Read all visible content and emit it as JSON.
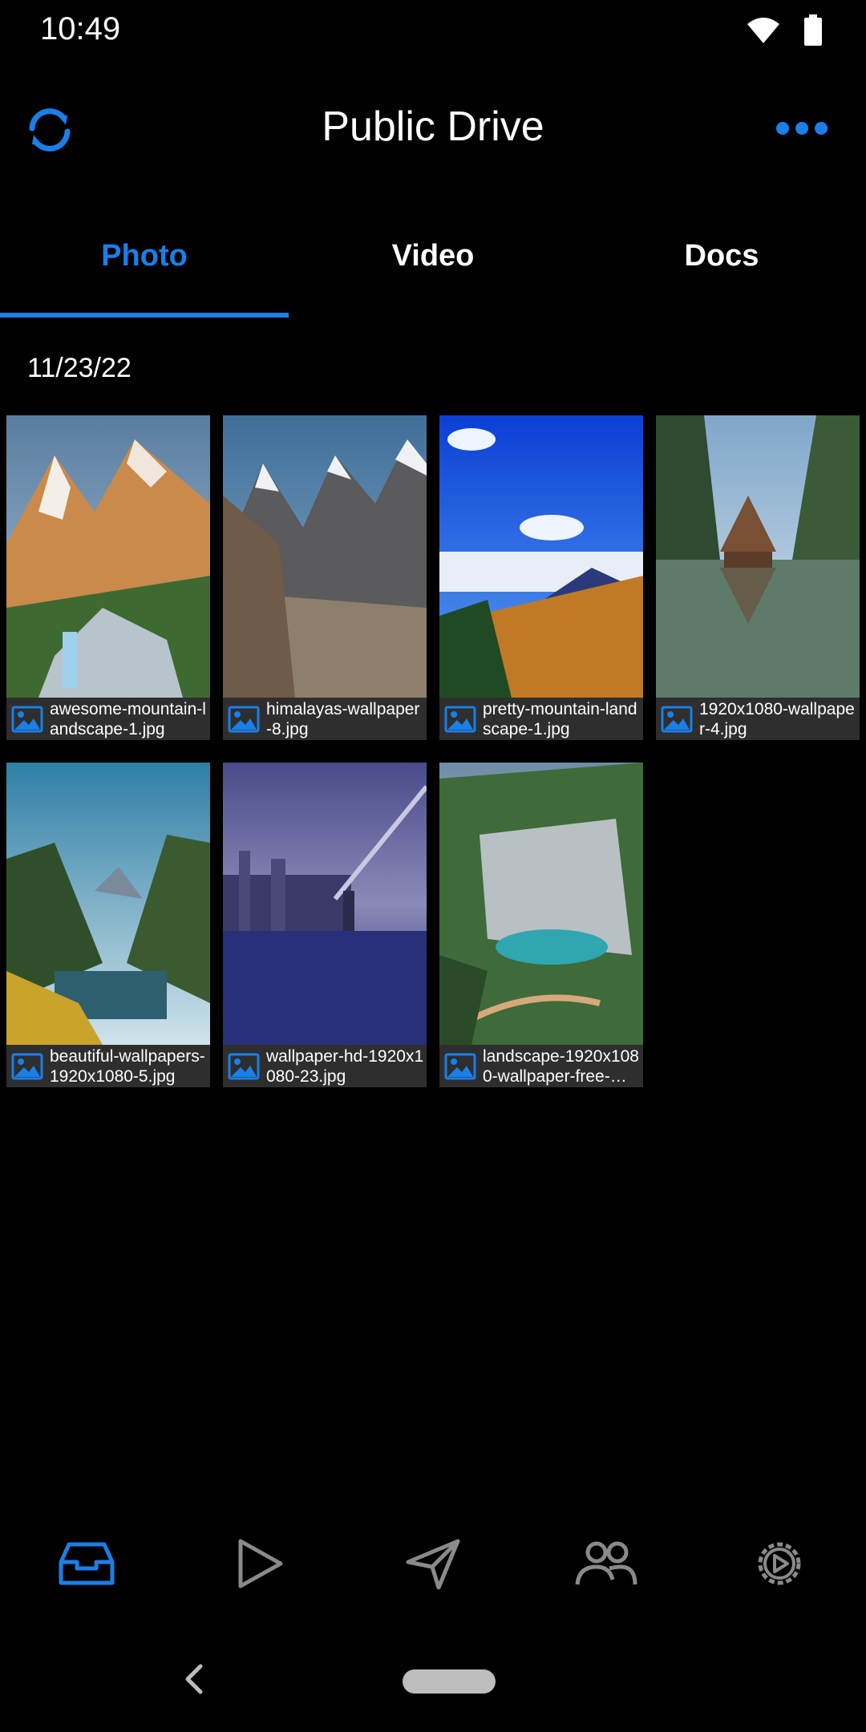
{
  "status": {
    "time": "10:49",
    "icons": [
      "wifi-icon",
      "battery-icon"
    ]
  },
  "app_bar": {
    "title": "Public Drive",
    "left_icon": "sync-icon",
    "right_icon": "more-icon"
  },
  "tabs": [
    {
      "label": "Photo",
      "active": true
    },
    {
      "label": "Video",
      "active": false
    },
    {
      "label": "Docs",
      "active": false
    }
  ],
  "date_group": "11/23/22",
  "files": [
    {
      "name": "awesome-mountain-landscape-1.jpg"
    },
    {
      "name": "himalayas-wallpaper-8.jpg"
    },
    {
      "name": "pretty-mountain-landscape-1.jpg"
    },
    {
      "name": "1920x1080-wallpaper-4.jpg"
    },
    {
      "name": "beautiful-wallpapers-1920x1080-5.jpg"
    },
    {
      "name": "wallpaper-hd-1920x1080-23.jpg"
    },
    {
      "name": "landscape-1920x1080-wallpaper-free-…"
    }
  ],
  "bottom_nav": [
    "inbox-icon",
    "play-icon",
    "send-icon",
    "people-icon",
    "settings-icon"
  ],
  "colors": {
    "accent": "#1a7fe8",
    "background": "#000000",
    "caption_bg": "#2e2e2e",
    "inactive_icon": "#8a8a8a"
  }
}
